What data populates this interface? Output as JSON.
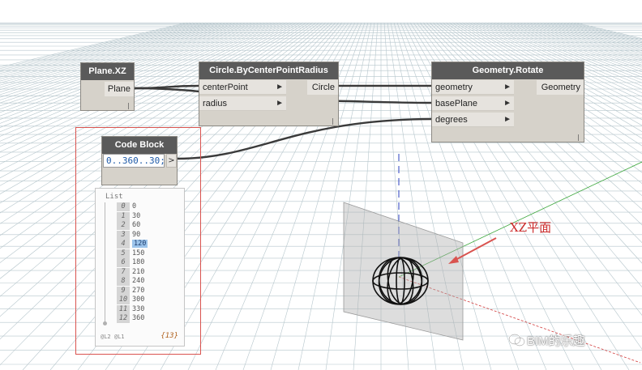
{
  "nodes": {
    "plane_xz": {
      "title": "Plane.XZ",
      "output": "Plane"
    },
    "circle": {
      "title": "Circle.ByCenterPointRadius",
      "inputs": [
        "centerPoint",
        "radius"
      ],
      "output": "Circle"
    },
    "rotate": {
      "title": "Geometry.Rotate",
      "inputs": [
        "geometry",
        "basePlane",
        "degrees"
      ],
      "output": "Geometry"
    },
    "code_block": {
      "title": "Code Block",
      "code": "0..360..30;",
      "output": ">"
    }
  },
  "list_preview": {
    "header": "List",
    "items": [
      {
        "index": "0",
        "value": "0"
      },
      {
        "index": "1",
        "value": "30"
      },
      {
        "index": "2",
        "value": "60"
      },
      {
        "index": "3",
        "value": "90"
      },
      {
        "index": "4",
        "value": "120"
      },
      {
        "index": "5",
        "value": "150"
      },
      {
        "index": "6",
        "value": "180"
      },
      {
        "index": "7",
        "value": "210"
      },
      {
        "index": "8",
        "value": "240"
      },
      {
        "index": "9",
        "value": "270"
      },
      {
        "index": "10",
        "value": "300"
      },
      {
        "index": "11",
        "value": "330"
      },
      {
        "index": "12",
        "value": "360"
      }
    ],
    "selected_index": 4,
    "levels": "@L2 @L1",
    "count": "{13}"
  },
  "annotation": {
    "label": "XZ平面",
    "color": "#cc2a2a"
  },
  "watermark": {
    "text": "BIM的乐趣"
  },
  "colors": {
    "node_header": "#5a5a5a",
    "node_body": "#d6d2ca",
    "wire": "#3a3a3a",
    "highlight": "#d9534f",
    "axis_x": "#d23b3b",
    "axis_y": "#3aa63a",
    "axis_z": "#2b3fbf"
  }
}
